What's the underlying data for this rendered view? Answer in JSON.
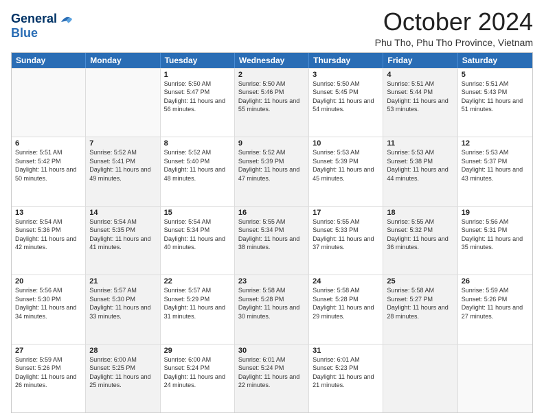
{
  "header": {
    "logo_line1": "General",
    "logo_line2": "Blue",
    "month": "October 2024",
    "location": "Phu Tho, Phu Tho Province, Vietnam"
  },
  "weekdays": [
    "Sunday",
    "Monday",
    "Tuesday",
    "Wednesday",
    "Thursday",
    "Friday",
    "Saturday"
  ],
  "weeks": [
    [
      {
        "day": "",
        "sunrise": "",
        "sunset": "",
        "daylight": "",
        "shaded": false,
        "empty": true
      },
      {
        "day": "",
        "sunrise": "",
        "sunset": "",
        "daylight": "",
        "shaded": false,
        "empty": true
      },
      {
        "day": "1",
        "sunrise": "Sunrise: 5:50 AM",
        "sunset": "Sunset: 5:47 PM",
        "daylight": "Daylight: 11 hours and 56 minutes.",
        "shaded": false,
        "empty": false
      },
      {
        "day": "2",
        "sunrise": "Sunrise: 5:50 AM",
        "sunset": "Sunset: 5:46 PM",
        "daylight": "Daylight: 11 hours and 55 minutes.",
        "shaded": true,
        "empty": false
      },
      {
        "day": "3",
        "sunrise": "Sunrise: 5:50 AM",
        "sunset": "Sunset: 5:45 PM",
        "daylight": "Daylight: 11 hours and 54 minutes.",
        "shaded": false,
        "empty": false
      },
      {
        "day": "4",
        "sunrise": "Sunrise: 5:51 AM",
        "sunset": "Sunset: 5:44 PM",
        "daylight": "Daylight: 11 hours and 53 minutes.",
        "shaded": true,
        "empty": false
      },
      {
        "day": "5",
        "sunrise": "Sunrise: 5:51 AM",
        "sunset": "Sunset: 5:43 PM",
        "daylight": "Daylight: 11 hours and 51 minutes.",
        "shaded": false,
        "empty": false
      }
    ],
    [
      {
        "day": "6",
        "sunrise": "Sunrise: 5:51 AM",
        "sunset": "Sunset: 5:42 PM",
        "daylight": "Daylight: 11 hours and 50 minutes.",
        "shaded": false,
        "empty": false
      },
      {
        "day": "7",
        "sunrise": "Sunrise: 5:52 AM",
        "sunset": "Sunset: 5:41 PM",
        "daylight": "Daylight: 11 hours and 49 minutes.",
        "shaded": true,
        "empty": false
      },
      {
        "day": "8",
        "sunrise": "Sunrise: 5:52 AM",
        "sunset": "Sunset: 5:40 PM",
        "daylight": "Daylight: 11 hours and 48 minutes.",
        "shaded": false,
        "empty": false
      },
      {
        "day": "9",
        "sunrise": "Sunrise: 5:52 AM",
        "sunset": "Sunset: 5:39 PM",
        "daylight": "Daylight: 11 hours and 47 minutes.",
        "shaded": true,
        "empty": false
      },
      {
        "day": "10",
        "sunrise": "Sunrise: 5:53 AM",
        "sunset": "Sunset: 5:39 PM",
        "daylight": "Daylight: 11 hours and 45 minutes.",
        "shaded": false,
        "empty": false
      },
      {
        "day": "11",
        "sunrise": "Sunrise: 5:53 AM",
        "sunset": "Sunset: 5:38 PM",
        "daylight": "Daylight: 11 hours and 44 minutes.",
        "shaded": true,
        "empty": false
      },
      {
        "day": "12",
        "sunrise": "Sunrise: 5:53 AM",
        "sunset": "Sunset: 5:37 PM",
        "daylight": "Daylight: 11 hours and 43 minutes.",
        "shaded": false,
        "empty": false
      }
    ],
    [
      {
        "day": "13",
        "sunrise": "Sunrise: 5:54 AM",
        "sunset": "Sunset: 5:36 PM",
        "daylight": "Daylight: 11 hours and 42 minutes.",
        "shaded": false,
        "empty": false
      },
      {
        "day": "14",
        "sunrise": "Sunrise: 5:54 AM",
        "sunset": "Sunset: 5:35 PM",
        "daylight": "Daylight: 11 hours and 41 minutes.",
        "shaded": true,
        "empty": false
      },
      {
        "day": "15",
        "sunrise": "Sunrise: 5:54 AM",
        "sunset": "Sunset: 5:34 PM",
        "daylight": "Daylight: 11 hours and 40 minutes.",
        "shaded": false,
        "empty": false
      },
      {
        "day": "16",
        "sunrise": "Sunrise: 5:55 AM",
        "sunset": "Sunset: 5:34 PM",
        "daylight": "Daylight: 11 hours and 38 minutes.",
        "shaded": true,
        "empty": false
      },
      {
        "day": "17",
        "sunrise": "Sunrise: 5:55 AM",
        "sunset": "Sunset: 5:33 PM",
        "daylight": "Daylight: 11 hours and 37 minutes.",
        "shaded": false,
        "empty": false
      },
      {
        "day": "18",
        "sunrise": "Sunrise: 5:55 AM",
        "sunset": "Sunset: 5:32 PM",
        "daylight": "Daylight: 11 hours and 36 minutes.",
        "shaded": true,
        "empty": false
      },
      {
        "day": "19",
        "sunrise": "Sunrise: 5:56 AM",
        "sunset": "Sunset: 5:31 PM",
        "daylight": "Daylight: 11 hours and 35 minutes.",
        "shaded": false,
        "empty": false
      }
    ],
    [
      {
        "day": "20",
        "sunrise": "Sunrise: 5:56 AM",
        "sunset": "Sunset: 5:30 PM",
        "daylight": "Daylight: 11 hours and 34 minutes.",
        "shaded": false,
        "empty": false
      },
      {
        "day": "21",
        "sunrise": "Sunrise: 5:57 AM",
        "sunset": "Sunset: 5:30 PM",
        "daylight": "Daylight: 11 hours and 33 minutes.",
        "shaded": true,
        "empty": false
      },
      {
        "day": "22",
        "sunrise": "Sunrise: 5:57 AM",
        "sunset": "Sunset: 5:29 PM",
        "daylight": "Daylight: 11 hours and 31 minutes.",
        "shaded": false,
        "empty": false
      },
      {
        "day": "23",
        "sunrise": "Sunrise: 5:58 AM",
        "sunset": "Sunset: 5:28 PM",
        "daylight": "Daylight: 11 hours and 30 minutes.",
        "shaded": true,
        "empty": false
      },
      {
        "day": "24",
        "sunrise": "Sunrise: 5:58 AM",
        "sunset": "Sunset: 5:28 PM",
        "daylight": "Daylight: 11 hours and 29 minutes.",
        "shaded": false,
        "empty": false
      },
      {
        "day": "25",
        "sunrise": "Sunrise: 5:58 AM",
        "sunset": "Sunset: 5:27 PM",
        "daylight": "Daylight: 11 hours and 28 minutes.",
        "shaded": true,
        "empty": false
      },
      {
        "day": "26",
        "sunrise": "Sunrise: 5:59 AM",
        "sunset": "Sunset: 5:26 PM",
        "daylight": "Daylight: 11 hours and 27 minutes.",
        "shaded": false,
        "empty": false
      }
    ],
    [
      {
        "day": "27",
        "sunrise": "Sunrise: 5:59 AM",
        "sunset": "Sunset: 5:26 PM",
        "daylight": "Daylight: 11 hours and 26 minutes.",
        "shaded": false,
        "empty": false
      },
      {
        "day": "28",
        "sunrise": "Sunrise: 6:00 AM",
        "sunset": "Sunset: 5:25 PM",
        "daylight": "Daylight: 11 hours and 25 minutes.",
        "shaded": true,
        "empty": false
      },
      {
        "day": "29",
        "sunrise": "Sunrise: 6:00 AM",
        "sunset": "Sunset: 5:24 PM",
        "daylight": "Daylight: 11 hours and 24 minutes.",
        "shaded": false,
        "empty": false
      },
      {
        "day": "30",
        "sunrise": "Sunrise: 6:01 AM",
        "sunset": "Sunset: 5:24 PM",
        "daylight": "Daylight: 11 hours and 22 minutes.",
        "shaded": true,
        "empty": false
      },
      {
        "day": "31",
        "sunrise": "Sunrise: 6:01 AM",
        "sunset": "Sunset: 5:23 PM",
        "daylight": "Daylight: 11 hours and 21 minutes.",
        "shaded": false,
        "empty": false
      },
      {
        "day": "",
        "sunrise": "",
        "sunset": "",
        "daylight": "",
        "shaded": true,
        "empty": true
      },
      {
        "day": "",
        "sunrise": "",
        "sunset": "",
        "daylight": "",
        "shaded": false,
        "empty": true
      }
    ]
  ]
}
